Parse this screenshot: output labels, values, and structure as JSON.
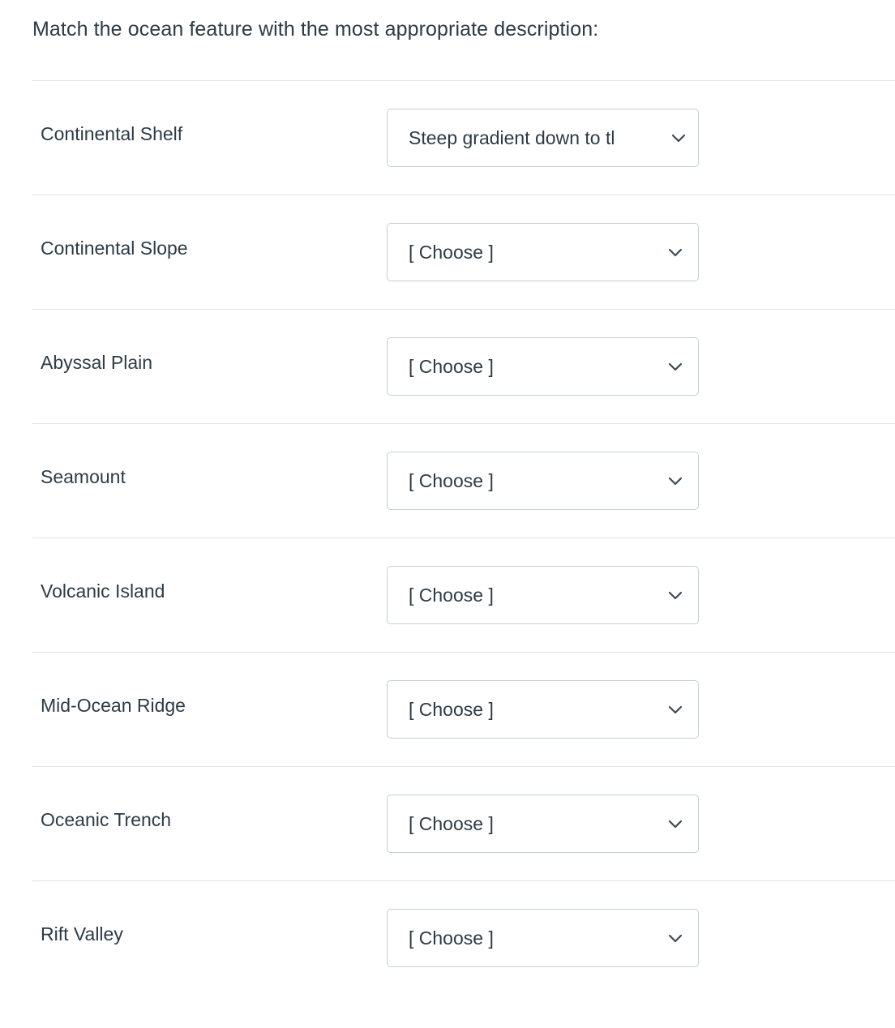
{
  "question": {
    "prompt": "Match the ocean feature with the most appropriate description:"
  },
  "placeholder_label": "[ Choose ]",
  "icons": {
    "chevron_down": "chevron-down-icon"
  },
  "colors": {
    "text": "#2d3b45",
    "border": "#c7cdd1",
    "divider": "#e1e3e5",
    "background": "#ffffff"
  },
  "rows": [
    {
      "label": "Continental Shelf",
      "value": "Steep gradient down to tl",
      "answered": true
    },
    {
      "label": "Continental Slope",
      "value": "[ Choose ]",
      "answered": false
    },
    {
      "label": "Abyssal Plain",
      "value": "[ Choose ]",
      "answered": false
    },
    {
      "label": "Seamount",
      "value": "[ Choose ]",
      "answered": false
    },
    {
      "label": "Volcanic Island",
      "value": "[ Choose ]",
      "answered": false
    },
    {
      "label": "Mid-Ocean Ridge",
      "value": "[ Choose ]",
      "answered": false
    },
    {
      "label": "Oceanic Trench",
      "value": "[ Choose ]",
      "answered": false
    },
    {
      "label": "Rift Valley",
      "value": "[ Choose ]",
      "answered": false
    }
  ]
}
